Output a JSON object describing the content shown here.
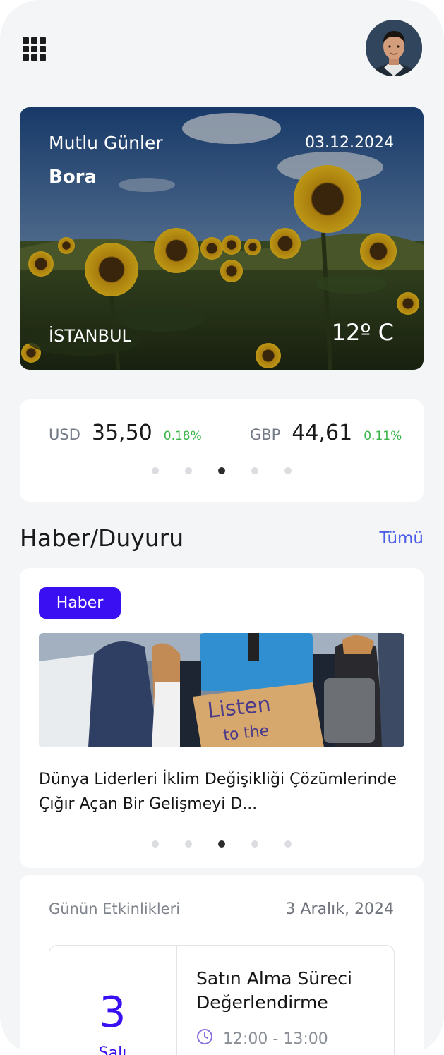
{
  "header": {
    "menu_icon": "grid-icon",
    "avatar": "user-avatar"
  },
  "hero": {
    "greeting": "Mutlu Günler",
    "name": "Bora",
    "date": "03.12.2024",
    "city": "İSTANBUL",
    "temperature": "12º C"
  },
  "currency": {
    "items": [
      {
        "code": "USD",
        "value": "35,50",
        "change": "0.18%"
      },
      {
        "code": "GBP",
        "value": "44,61",
        "change": "0.11%"
      }
    ],
    "pager": {
      "count": 5,
      "active": 3
    }
  },
  "news_section": {
    "title": "Haber/Duyuru",
    "see_all": "Tümü",
    "card": {
      "badge": "Haber",
      "headline": "Dünya Liderleri İklim Değişikliği Çözümlerinde Çığır Açan Bir Gelişmeyi D...",
      "pager": {
        "count": 5,
        "active": 3
      }
    }
  },
  "events": {
    "label": "Günün Etkinlikleri",
    "date": "3 Aralık, 2024",
    "item": {
      "day": "3",
      "weekday": "Salı",
      "title": "Satın Alma Süreci Değerlendirme",
      "time": "12:00 - 13:00"
    }
  },
  "colors": {
    "accent": "#3a10f2",
    "link": "#4a5ce8",
    "positive": "#3bb54a",
    "background": "#f4f5f7"
  }
}
